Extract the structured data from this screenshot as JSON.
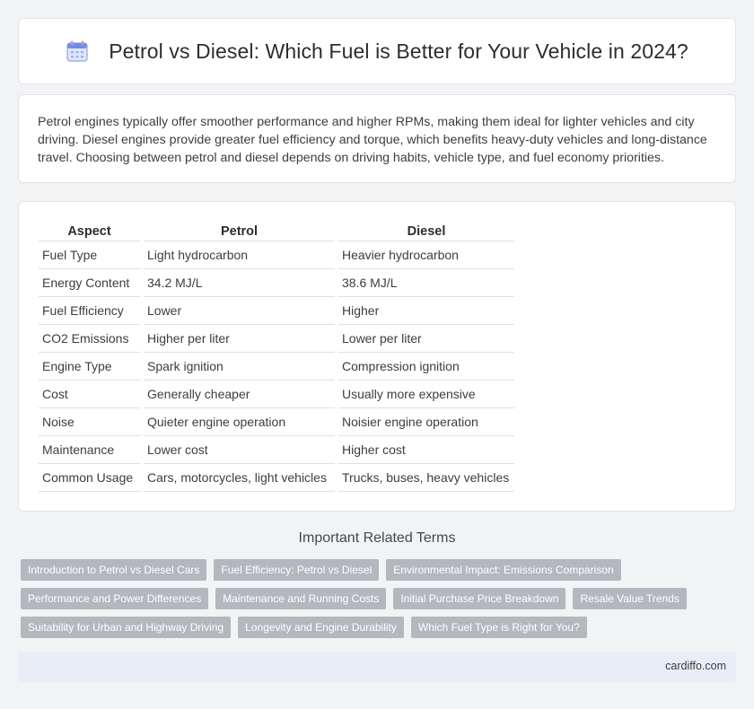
{
  "header": {
    "title": "Petrol vs Diesel: Which Fuel is Better for Your Vehicle in 2024?",
    "icon": "calendar-icon"
  },
  "intro": {
    "text": "Petrol engines typically offer smoother performance and higher RPMs, making them ideal for lighter vehicles and city driving. Diesel engines provide greater fuel efficiency and torque, which benefits heavy-duty vehicles and long-distance travel. Choosing between petrol and diesel depends on driving habits, vehicle type, and fuel economy priorities."
  },
  "table": {
    "headers": [
      "Aspect",
      "Petrol",
      "Diesel"
    ],
    "rows": [
      [
        "Fuel Type",
        "Light hydrocarbon",
        "Heavier hydrocarbon"
      ],
      [
        "Energy Content",
        "34.2 MJ/L",
        "38.6 MJ/L"
      ],
      [
        "Fuel Efficiency",
        "Lower",
        "Higher"
      ],
      [
        "CO2 Emissions",
        "Higher per liter",
        "Lower per liter"
      ],
      [
        "Engine Type",
        "Spark ignition",
        "Compression ignition"
      ],
      [
        "Cost",
        "Generally cheaper",
        "Usually more expensive"
      ],
      [
        "Noise",
        "Quieter engine operation",
        "Noisier engine operation"
      ],
      [
        "Maintenance",
        "Lower cost",
        "Higher cost"
      ],
      [
        "Common Usage",
        "Cars, motorcycles, light vehicles",
        "Trucks, buses, heavy vehicles"
      ]
    ]
  },
  "related": {
    "title": "Important Related Terms",
    "tags": [
      "Introduction to Petrol vs Diesel Cars",
      "Fuel Efficiency: Petrol vs Diesel",
      "Environmental Impact: Emissions Comparison",
      "Performance and Power Differences",
      "Maintenance and Running Costs",
      "Initial Purchase Price Breakdown",
      "Resale Value Trends",
      "Suitability for Urban and Highway Driving",
      "Longevity and Engine Durability",
      "Which Fuel Type is Right for You?"
    ]
  },
  "footer": {
    "site": "cardiffo.com"
  },
  "colors": {
    "tag_bg": "#b3b8bf",
    "footer_bg": "#e9edf5",
    "icon_primary": "#6a8ee6",
    "icon_accent": "#e98aa8"
  }
}
